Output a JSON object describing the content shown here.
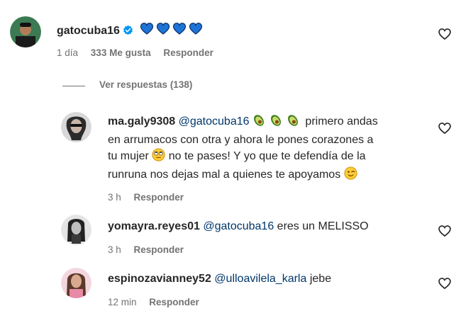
{
  "main_comment": {
    "username": "gatocuba16",
    "text_emoji": "💙💙💙💙",
    "time": "1 día",
    "likes": "333 Me gusta",
    "reply_label": "Responder"
  },
  "view_replies": {
    "label": "Ver respuestas (138)"
  },
  "replies": [
    {
      "username": "ma.galy9308",
      "mention": "@gatocuba16",
      "text_line1_after": "primero andas",
      "text_line2": "en arrumacos con otra y ahora le pones corazones a",
      "text_line3_before": "tu mujer",
      "text_line3_after": "no te pases! Y yo que te defendía de la",
      "text_line4": "runruna nos dejas mal a quienes te apoyamos",
      "time": "3 h",
      "reply_label": "Responder"
    },
    {
      "username": "yomayra.reyes01",
      "mention": "@gatocuba16",
      "text": "eres un MELISSO",
      "time": "3 h",
      "reply_label": "Responder"
    },
    {
      "username": "espinozavianney52",
      "mention": "@ulloavilela_karla",
      "text": "jebe",
      "time": "12 min",
      "reply_label": "Responder"
    }
  ],
  "colors": {
    "text": "#262626",
    "secondary": "#737373",
    "mention": "#00376b",
    "verified": "#0095f6",
    "heart_emoji": "#1877f2"
  },
  "icons": [
    "verified-badge-icon",
    "heart-outline-icon",
    "avocado-emoji",
    "rolling-eyes-emoji",
    "wink-emoji",
    "blue-heart-emoji"
  ]
}
